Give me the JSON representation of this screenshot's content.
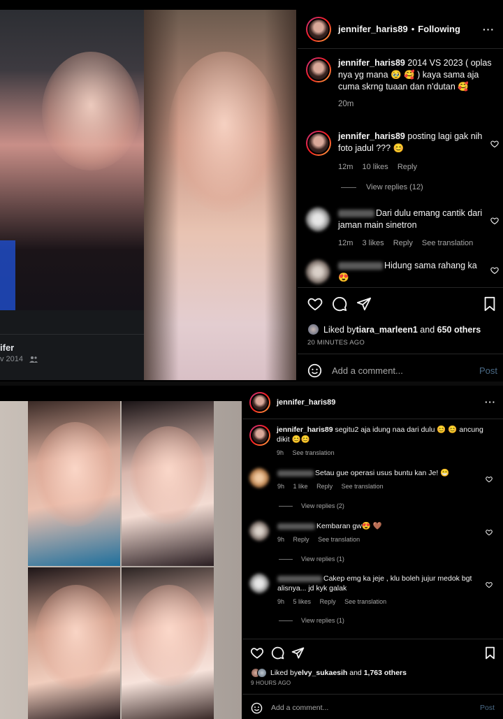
{
  "post1": {
    "header": {
      "username": "jennifer_haris89",
      "dot": "•",
      "following": "Following",
      "more": "···"
    },
    "left_photo": {
      "name_fragment": "ifer",
      "date_fragment": "v 2014"
    },
    "caption": {
      "username": "jennifer_haris89",
      "text": " 2014 VS 2023 ( oplas nya yg mana 🥹 🥰 ) kaya sama aja cuma skrng tuaan dan n'dutan 🥰",
      "time": "20m"
    },
    "comments": [
      {
        "username": "jennifer_haris89",
        "text": " posting lagi gak nih foto jadul ??? 😊",
        "time": "12m",
        "likes": "10 likes",
        "reply": "Reply",
        "view_replies": "View replies (12)"
      },
      {
        "text": "Dari dulu emang cantik dari jaman main sinetron",
        "time": "12m",
        "likes": "3 likes",
        "reply": "Reply",
        "see_translation": "See translation"
      },
      {
        "text": "Hidung sama rahang ka 😍"
      }
    ],
    "liked_by": {
      "prefix": "Liked by ",
      "user": "tiara_marleen1",
      "and": " and ",
      "others": "650 others"
    },
    "time_ago": "20 MINUTES AGO",
    "add_comment": {
      "placeholder": "Add a comment...",
      "post": "Post"
    }
  },
  "post2": {
    "header": {
      "username": "jennifer_haris89",
      "more": "···"
    },
    "caption": {
      "username": "jennifer_haris89",
      "text": " segitu2 aja idung naa dari dulu 😊 😊 ancung dikit 😊😊",
      "time": "9h",
      "see_translation": "See translation"
    },
    "comments": [
      {
        "text": "Setau gue operasi usus buntu kan Je! 😁",
        "time": "9h",
        "likes": "1 like",
        "reply": "Reply",
        "see_translation": "See translation",
        "view_replies": "View replies (2)"
      },
      {
        "text": "Kembaran gw😍 🤎",
        "time": "9h",
        "reply": "Reply",
        "see_translation": "See translation",
        "view_replies": "View replies (1)"
      },
      {
        "text": "Cakep emg ka jeje , klu boleh jujur medok bgt alisnya... jd kyk galak",
        "time": "9h",
        "likes": "5 likes",
        "reply": "Reply",
        "see_translation": "See translation",
        "view_replies": "View replies (1)"
      }
    ],
    "liked_by": {
      "prefix": "Liked by ",
      "user": "elvy_sukaesih",
      "and": " and ",
      "others": "1,763 others"
    },
    "time_ago": "9 HOURS AGO",
    "add_comment": {
      "placeholder": "Add a comment...",
      "post": "Post"
    }
  },
  "icons": [
    "heart-icon",
    "comment-icon",
    "share-icon",
    "bookmark-icon",
    "emoji-icon",
    "more-icon"
  ]
}
